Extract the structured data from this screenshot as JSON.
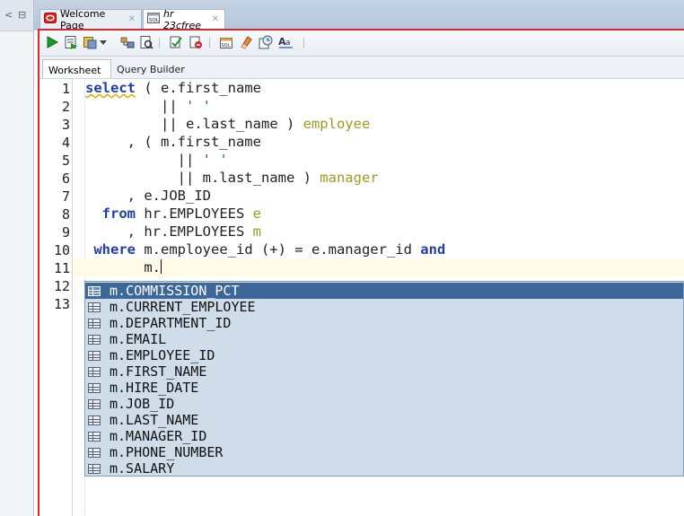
{
  "tabs": [
    {
      "label": "Welcome Page",
      "icon": "oracle-icon"
    },
    {
      "label": "hr 23cfree",
      "icon": "sql-worksheet-icon"
    }
  ],
  "subtabs": {
    "worksheet": "Worksheet",
    "query_builder": "Query Builder"
  },
  "toolbar_icons": [
    "run-statement-icon",
    "run-script-icon",
    "autotrace-icon",
    "dropdown-icon",
    "explain-plan-icon",
    "sql-tuning-icon",
    "commit-icon",
    "rollback-icon",
    "unshared-sql-icon",
    "clear-icon",
    "sql-history-icon",
    "format-icon"
  ],
  "line_numbers": [
    "1",
    "2",
    "3",
    "4",
    "5",
    "6",
    "7",
    "8",
    "9",
    "10",
    "11",
    "12",
    "13"
  ],
  "code": {
    "l1": {
      "kw": "select",
      "text": " ( e.first_name"
    },
    "l2": {
      "indent": "         ",
      "text": "|| ",
      "str": "' '"
    },
    "l3": {
      "indent": "         ",
      "text": "|| e.last_name ) ",
      "alias": "employee"
    },
    "l4": {
      "text": "     , ( m.first_name"
    },
    "l5": {
      "indent": "           ",
      "text": "|| ",
      "str": "' '"
    },
    "l6": {
      "indent": "           ",
      "text": "|| m.last_name ) ",
      "alias": "manager"
    },
    "l7": {
      "text": "     , e.JOB_ID"
    },
    "l8": {
      "kw": "  from",
      "text": " hr.EMPLOYEES ",
      "alias": "e"
    },
    "l9": {
      "text": "     , hr.EMPLOYEES ",
      "alias": "m"
    },
    "l10": {
      "kw1": " where",
      "text": " m.employee_id (+) = e.manager_id ",
      "kw2": "and"
    },
    "l11": {
      "text": "       m."
    }
  },
  "completion": {
    "selected_index": 0,
    "items": [
      "m.COMMISSION_PCT",
      "m.CURRENT_EMPLOYEE",
      "m.DEPARTMENT_ID",
      "m.EMAIL",
      "m.EMPLOYEE_ID",
      "m.FIRST_NAME",
      "m.HIRE_DATE",
      "m.JOB_ID",
      "m.LAST_NAME",
      "m.MANAGER_ID",
      "m.PHONE_NUMBER",
      "m.SALARY"
    ]
  },
  "colors": {
    "keyword": "#1f3fa8",
    "alias": "#9c9c1e",
    "string": "#1a8a1a",
    "selection": "#3b679a",
    "popup_bg": "#cfdcea",
    "frame_accent": "#d42a2a"
  }
}
